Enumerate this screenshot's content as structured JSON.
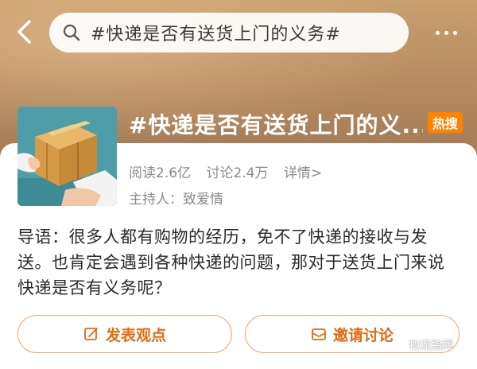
{
  "header": {
    "search_text": "#快递是否有送货上门的义务#"
  },
  "topic": {
    "title": "#快递是否有送货上门的义...",
    "badge": "热搜",
    "reads": "阅读2.6亿",
    "discussions": "讨论2.4万",
    "details": "详情>",
    "host": "主持人：致爱情"
  },
  "intro": "导语：很多人都有购物的经历，免不了快递的接收与发送。也肯定会遇到各种快递的问题，那对于送货上门来说快递是否有义务呢？",
  "actions": {
    "post_label": "发表观点",
    "invite_label": "邀请讨论"
  },
  "watermark": "物流指闻",
  "colors": {
    "accent": "#e06a14",
    "badge": "#ff8200",
    "border": "#f2a35f",
    "hero": "#b98e63"
  },
  "icons": {
    "back": "chevron-left-icon",
    "search": "search-icon",
    "more": "more-dots-icon",
    "post": "edit-icon",
    "invite": "invite-icon"
  }
}
